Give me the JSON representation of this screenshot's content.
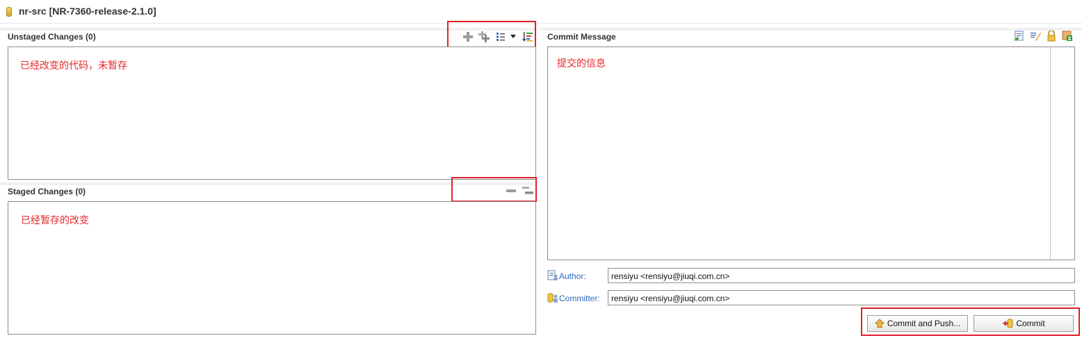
{
  "window": {
    "title": "nr-src [NR-7360-release-2.1.0]"
  },
  "unstaged": {
    "label": "Unstaged Changes (0)",
    "note": "已经改变的代码，未暂存"
  },
  "staged": {
    "label": "Staged Changes (0)",
    "note": "已经暂存的改变"
  },
  "commit": {
    "label": "Commit Message",
    "note": "提交的信息",
    "author_label": "Author:",
    "author_value": "rensiyu <rensiyu@jiuqi.com.cn>",
    "committer_label": "Committer:",
    "committer_value": "rensiyu <rensiyu@jiuqi.com.cn>",
    "commit_and_push_label": "Commit and Push...",
    "commit_label": "Commit"
  },
  "icons": {
    "unstaged_toolbar": [
      "add-to-index-icon",
      "add-all-to-index-icon",
      "presentation-list-icon",
      "dropdown-arrow-icon",
      "sort-icon"
    ],
    "staged_toolbar": [
      "remove-from-index-icon",
      "remove-all-from-index-icon"
    ],
    "commit_toolbar": [
      "amend-icon",
      "signed-off-icon",
      "signoff-lock-icon",
      "change-id-icon"
    ]
  },
  "colors": {
    "annotation_red": "#e0202a",
    "label_blue": "#2c6ebc"
  }
}
